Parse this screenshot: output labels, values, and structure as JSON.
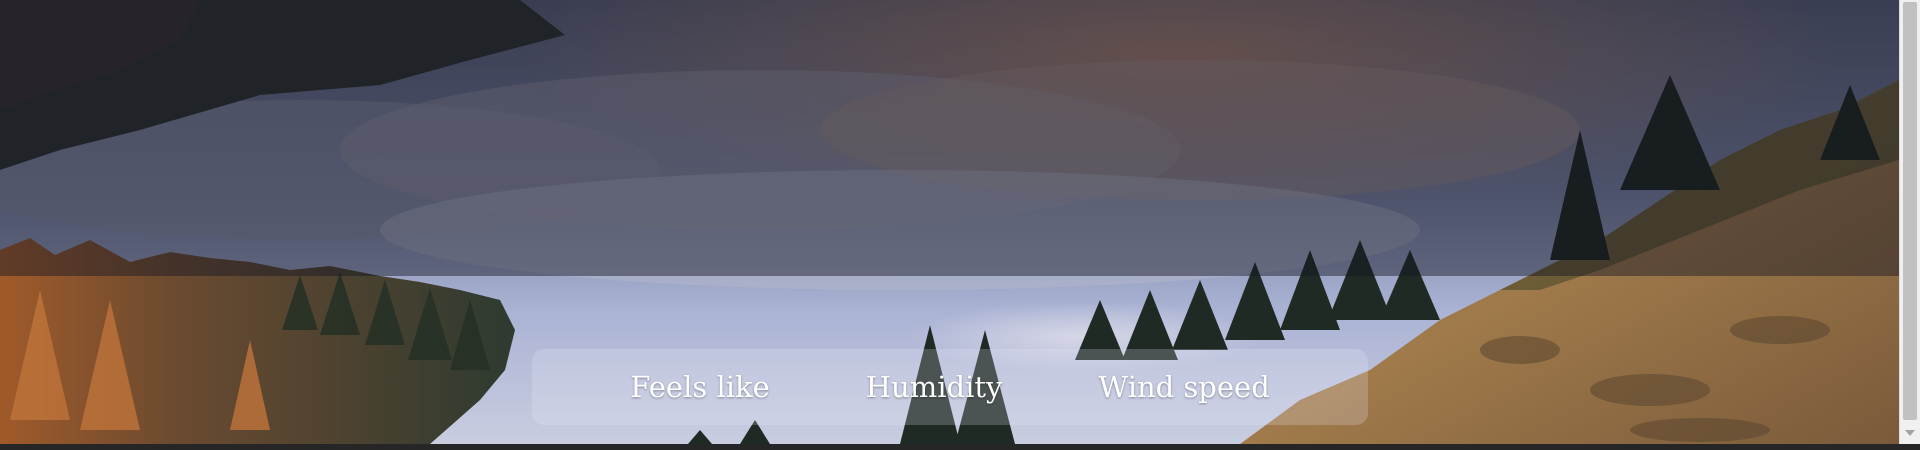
{
  "weather_details": {
    "feels_like_label": "Feels like",
    "humidity_label": "Humidity",
    "wind_speed_label": "Wind speed"
  },
  "background": {
    "description_icon": "landscape-photo",
    "sky_color": "#8a95b8",
    "forest_color": "#2e3b2a",
    "hillside_color": "#8a6a3e"
  },
  "scrollbar": {
    "down_arrow_icon": "chevron-down-icon"
  }
}
